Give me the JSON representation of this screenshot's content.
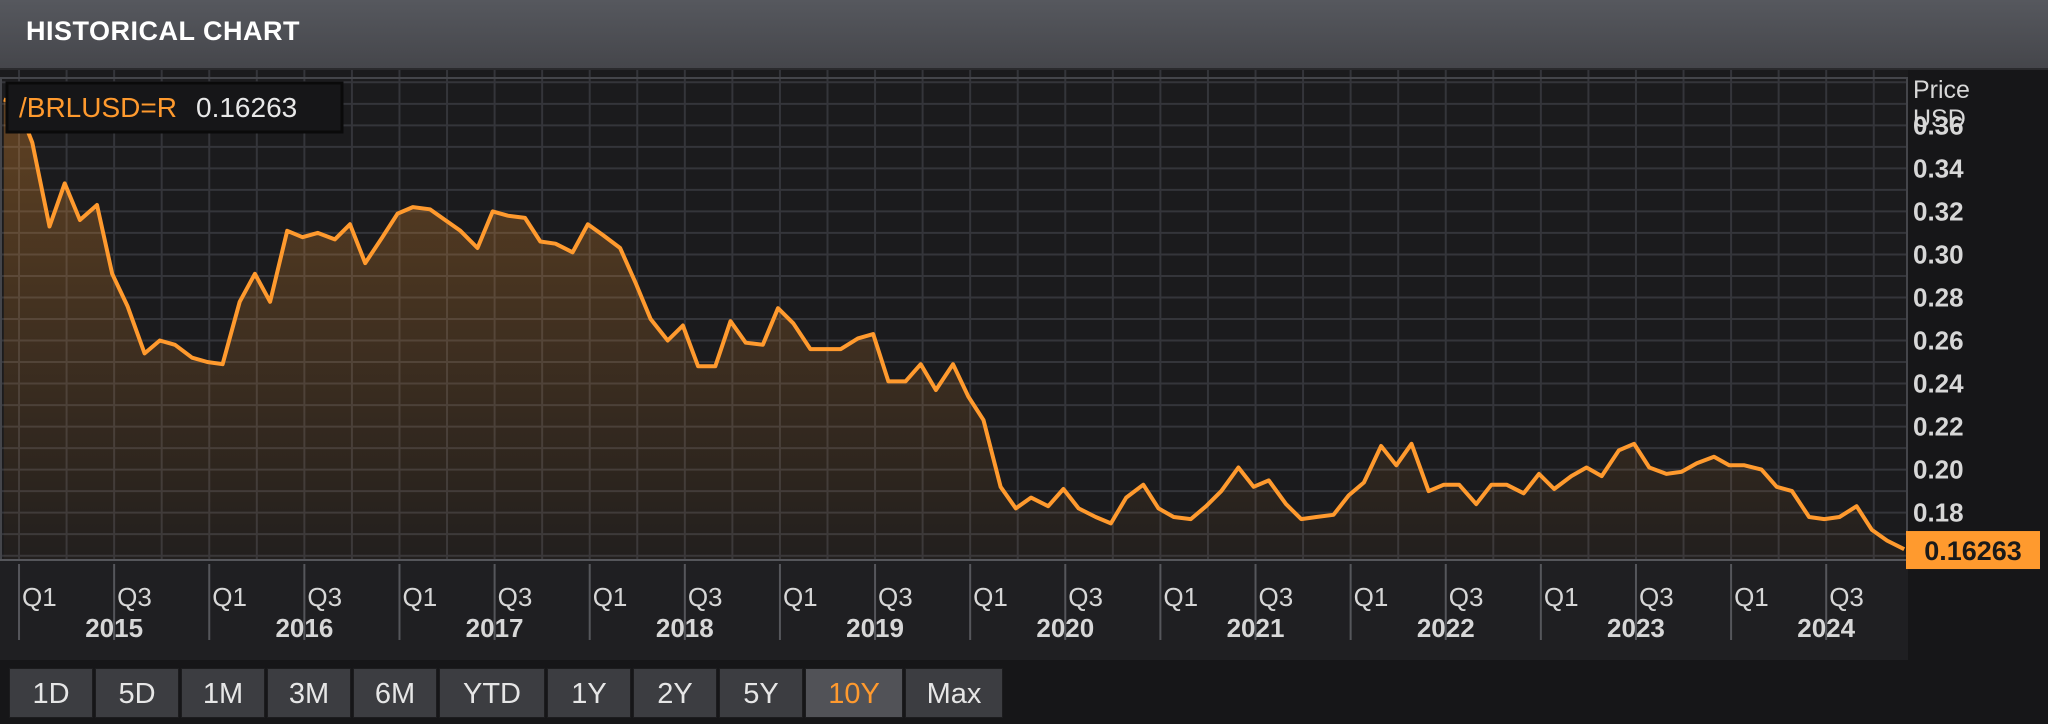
{
  "header": {
    "title": "HISTORICAL CHART"
  },
  "legend": {
    "symbol": "/BRLUSD=R",
    "value": "0.16263"
  },
  "colors": {
    "series": "#ff9a2e",
    "grid": "#3a3b3f",
    "text": "#d7d7d7"
  },
  "chart_data": {
    "type": "area",
    "title": "",
    "ylabel": "Price USD",
    "ylabel_lines": [
      "Price",
      "USD"
    ],
    "ylim": [
      0.158,
      0.382
    ],
    "yticks": [
      0.18,
      0.2,
      0.22,
      0.24,
      0.26,
      0.28,
      0.3,
      0.32,
      0.34,
      0.36
    ],
    "ytick_labels": [
      "0.18",
      "0.20",
      "0.22",
      "0.24",
      "0.26",
      "0.28",
      "0.30",
      "0.32",
      "0.34",
      "0.36"
    ],
    "xlim": [
      2014.9,
      2024.93
    ],
    "xticks": [
      {
        "label": "Q1",
        "x": 2015.0
      },
      {
        "label": "Q3",
        "x": 2015.5
      },
      {
        "label": "Q1",
        "x": 2016.0
      },
      {
        "label": "Q3",
        "x": 2016.5
      },
      {
        "label": "Q1",
        "x": 2017.0
      },
      {
        "label": "Q3",
        "x": 2017.5
      },
      {
        "label": "Q1",
        "x": 2018.0
      },
      {
        "label": "Q3",
        "x": 2018.5
      },
      {
        "label": "Q1",
        "x": 2019.0
      },
      {
        "label": "Q3",
        "x": 2019.5
      },
      {
        "label": "Q1",
        "x": 2020.0
      },
      {
        "label": "Q3",
        "x": 2020.5
      },
      {
        "label": "Q1",
        "x": 2021.0
      },
      {
        "label": "Q3",
        "x": 2021.5
      },
      {
        "label": "Q1",
        "x": 2022.0
      },
      {
        "label": "Q3",
        "x": 2022.5
      },
      {
        "label": "Q1",
        "x": 2023.0
      },
      {
        "label": "Q3",
        "x": 2023.5
      },
      {
        "label": "Q1",
        "x": 2024.0
      },
      {
        "label": "Q3",
        "x": 2024.5
      }
    ],
    "years": [
      {
        "label": "2015",
        "x": 2015.5
      },
      {
        "label": "2016",
        "x": 2016.5
      },
      {
        "label": "2017",
        "x": 2017.5
      },
      {
        "label": "2018",
        "x": 2018.5
      },
      {
        "label": "2019",
        "x": 2019.5
      },
      {
        "label": "2020",
        "x": 2020.5
      },
      {
        "label": "2021",
        "x": 2021.5
      },
      {
        "label": "2022",
        "x": 2022.5
      },
      {
        "label": "2023",
        "x": 2023.5
      },
      {
        "label": "2024",
        "x": 2024.5
      }
    ],
    "last_value": 0.16263,
    "last_value_label": "0.16263",
    "series": [
      {
        "x": [
          2014.92,
          2014.99,
          2015.07,
          2015.16,
          2015.24,
          2015.32,
          2015.41,
          2015.49,
          2015.57,
          2015.66,
          2015.74,
          2015.82,
          2015.91,
          2015.99,
          2016.07,
          2016.16,
          2016.24,
          2016.32,
          2016.41,
          2016.49,
          2016.57,
          2016.66,
          2016.74,
          2016.82,
          2016.91,
          2016.99,
          2017.07,
          2017.16,
          2017.24,
          2017.32,
          2017.41,
          2017.49,
          2017.57,
          2017.66,
          2017.74,
          2017.82,
          2017.91,
          2017.99,
          2018.07,
          2018.16,
          2018.24,
          2018.32,
          2018.41,
          2018.49,
          2018.57,
          2018.66,
          2018.74,
          2018.82,
          2018.91,
          2018.99,
          2019.07,
          2019.16,
          2019.24,
          2019.32,
          2019.41,
          2019.49,
          2019.57,
          2019.66,
          2019.74,
          2019.82,
          2019.91,
          2019.99,
          2020.07,
          2020.16,
          2020.24,
          2020.32,
          2020.41,
          2020.49,
          2020.57,
          2020.66,
          2020.74,
          2020.82,
          2020.91,
          2020.99,
          2021.07,
          2021.16,
          2021.24,
          2021.32,
          2021.41,
          2021.49,
          2021.57,
          2021.66,
          2021.74,
          2021.82,
          2021.91,
          2021.99,
          2022.07,
          2022.16,
          2022.24,
          2022.32,
          2022.41,
          2022.49,
          2022.57,
          2022.66,
          2022.74,
          2022.82,
          2022.91,
          2022.99,
          2023.07,
          2023.16,
          2023.24,
          2023.32,
          2023.41,
          2023.49,
          2023.57,
          2023.66,
          2023.74,
          2023.82,
          2023.91,
          2023.99,
          2024.07,
          2024.16,
          2024.24,
          2024.32,
          2024.41,
          2024.49,
          2024.57,
          2024.66,
          2024.74,
          2024.82,
          2024.91
        ],
        "y": [
          0.372,
          0.37,
          0.352,
          0.313,
          0.333,
          0.316,
          0.323,
          0.291,
          0.276,
          0.254,
          0.26,
          0.258,
          0.252,
          0.25,
          0.249,
          0.278,
          0.291,
          0.278,
          0.311,
          0.308,
          0.31,
          0.307,
          0.314,
          0.296,
          0.308,
          0.319,
          0.322,
          0.321,
          0.316,
          0.311,
          0.303,
          0.32,
          0.318,
          0.317,
          0.306,
          0.305,
          0.301,
          0.314,
          0.309,
          0.303,
          0.287,
          0.27,
          0.26,
          0.267,
          0.248,
          0.248,
          0.269,
          0.259,
          0.258,
          0.275,
          0.268,
          0.256,
          0.256,
          0.256,
          0.261,
          0.263,
          0.241,
          0.241,
          0.249,
          0.237,
          0.249,
          0.234,
          0.223,
          0.192,
          0.182,
          0.187,
          0.183,
          0.191,
          0.182,
          0.178,
          0.175,
          0.187,
          0.193,
          0.182,
          0.178,
          0.177,
          0.183,
          0.19,
          0.201,
          0.192,
          0.195,
          0.184,
          0.177,
          0.178,
          0.179,
          0.188,
          0.194,
          0.211,
          0.202,
          0.212,
          0.19,
          0.193,
          0.193,
          0.184,
          0.193,
          0.193,
          0.189,
          0.198,
          0.191,
          0.197,
          0.201,
          0.197,
          0.209,
          0.212,
          0.201,
          0.198,
          0.199,
          0.203,
          0.206,
          0.202,
          0.202,
          0.2,
          0.192,
          0.19,
          0.178,
          0.177,
          0.178,
          0.183,
          0.172,
          0.167,
          0.163
        ]
      }
    ]
  },
  "ranges": {
    "buttons": [
      {
        "label": "1D"
      },
      {
        "label": "5D"
      },
      {
        "label": "1M"
      },
      {
        "label": "3M"
      },
      {
        "label": "6M"
      },
      {
        "label": "YTD"
      },
      {
        "label": "1Y"
      },
      {
        "label": "2Y"
      },
      {
        "label": "5Y"
      },
      {
        "label": "10Y"
      },
      {
        "label": "Max"
      }
    ],
    "active_label": "10Y"
  }
}
